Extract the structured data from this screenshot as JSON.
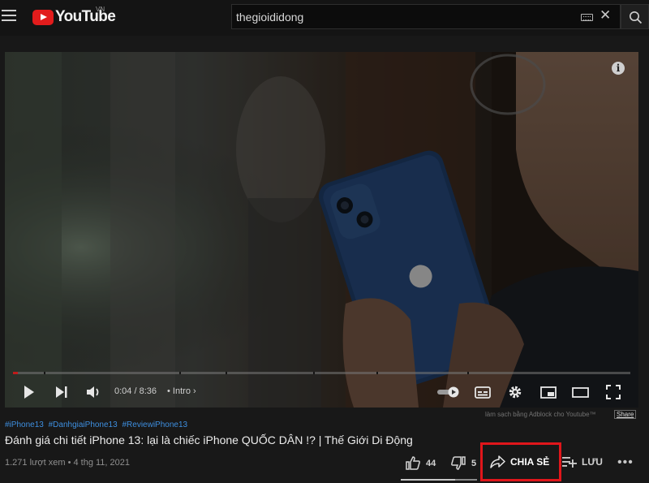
{
  "header": {
    "logo_text": "YouTube",
    "region": "VN",
    "search_value": "thegioididong"
  },
  "player": {
    "current_time": "0:04",
    "duration": "8:36",
    "time_separator": "/",
    "chapter": "Intro",
    "chapter_arrow": "›",
    "progress_fraction": 0.008
  },
  "video": {
    "hashtags": [
      "#iPhone13",
      "#DanhgiaiPhone13",
      "#ReviewiPhone13"
    ],
    "adblock_note": "làm sạch bằng Adblock cho Youtube™",
    "adblock_share": "Share",
    "title": "Đánh giá chi tiết iPhone 13: lại là chiếc iPhone QUỐC DÂN !? | Thế Giới Di Động",
    "views": "1.271 lượt xem",
    "date": "4 thg 11, 2021",
    "meta_separator": "•"
  },
  "actions": {
    "likes": "44",
    "dislikes": "5",
    "share_label": "CHIA SẺ",
    "save_label": "LƯU"
  },
  "colors": {
    "accent": "#e21c1c",
    "highlight_box": "#e0161b",
    "hashtag": "#3e8fe0"
  }
}
